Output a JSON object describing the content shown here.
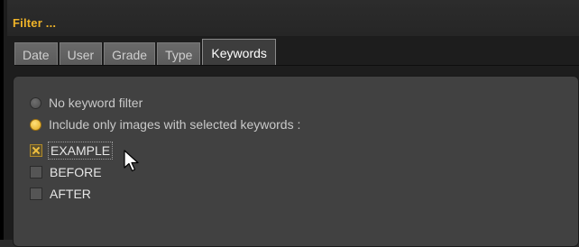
{
  "dialog": {
    "title": "Filter ..."
  },
  "tabs": [
    {
      "label": "Date",
      "active": false
    },
    {
      "label": "User",
      "active": false
    },
    {
      "label": "Grade",
      "active": false
    },
    {
      "label": "Type",
      "active": false
    },
    {
      "label": "Keywords",
      "active": true
    }
  ],
  "keywords_panel": {
    "radio_options": [
      {
        "label": "No keyword filter",
        "selected": false
      },
      {
        "label": "Include only images with selected keywords :",
        "selected": true
      }
    ],
    "keywords": [
      {
        "label": "EXAMPLE",
        "checked": true
      },
      {
        "label": "BEFORE",
        "checked": false
      },
      {
        "label": "AFTER",
        "checked": false
      }
    ]
  },
  "colors": {
    "accent": "#f0b429",
    "panel_bg": "#414141",
    "window_bg": "#1d1d1d"
  },
  "icons": {
    "cursor": "arrow-cursor-icon"
  }
}
